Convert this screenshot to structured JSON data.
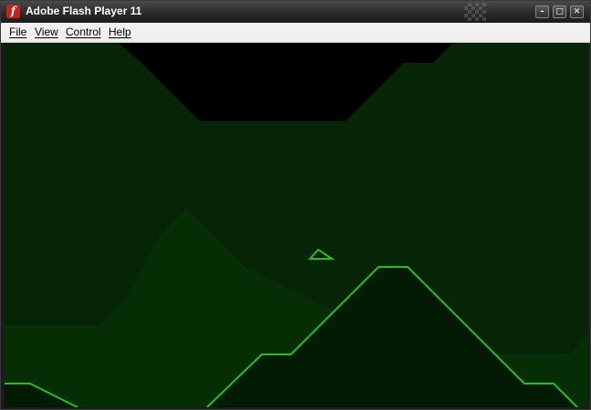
{
  "window": {
    "title": "Adobe Flash Player 11",
    "icon": "flash-icon",
    "controls": {
      "minimize_icon": "minimize-icon",
      "maximize_icon": "maximize-icon",
      "close_icon": "close-icon"
    }
  },
  "menu": {
    "file": "File",
    "view": "View",
    "control": "Control",
    "help": "Help"
  },
  "game": {
    "type": "cave-scroller",
    "player_ship": "triangle-ship",
    "colors": {
      "sky_void": "#000000",
      "cave_far": "#062406",
      "hills_mid": "#052e05",
      "ground_near": "#031a03",
      "outline": "#22c022"
    }
  }
}
